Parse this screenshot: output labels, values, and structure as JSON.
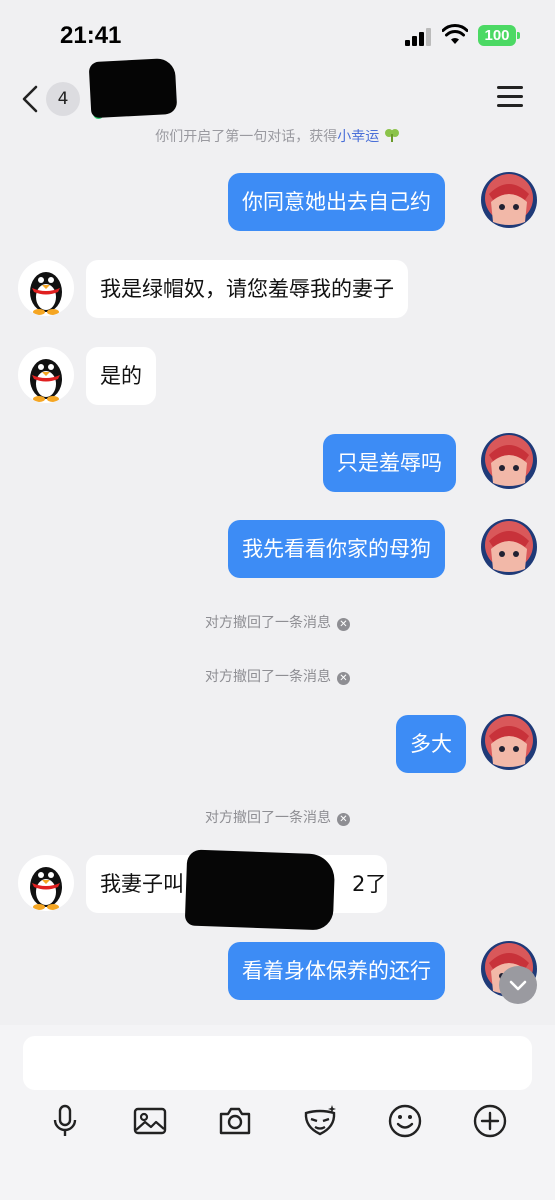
{
  "status_bar": {
    "time": "21:41",
    "battery": "100"
  },
  "header": {
    "unread_count": "4"
  },
  "chat": {
    "system_tip_prefix": "你们开启了第一句对话，获得",
    "system_tip_accent": "小幸运",
    "recall_notice": "对方撤回了一条消息",
    "messages": [
      {
        "from": "me",
        "text": "你同意她出去自己约"
      },
      {
        "from": "them",
        "text": "我是绿帽奴，请您羞辱我的妻子"
      },
      {
        "from": "them",
        "text": "是的"
      },
      {
        "from": "me",
        "text": "只是羞辱吗"
      },
      {
        "from": "me",
        "text": "我先看看你家的母狗"
      },
      {
        "from": "me",
        "text": "多大"
      },
      {
        "from": "them",
        "text_start": "我妻子叫",
        "text_end": "2了"
      },
      {
        "from": "me",
        "text": "看着身体保养的还行"
      }
    ]
  },
  "icons": {
    "toolbar": [
      "microphone-icon",
      "image-icon",
      "camera-icon",
      "mask-icon",
      "emoji-icon",
      "plus-icon"
    ]
  },
  "colors": {
    "my_bubble": "#3d8cf5",
    "accent": "#4a6fd8",
    "online": "#2ecc71",
    "battery": "#4cd964"
  }
}
